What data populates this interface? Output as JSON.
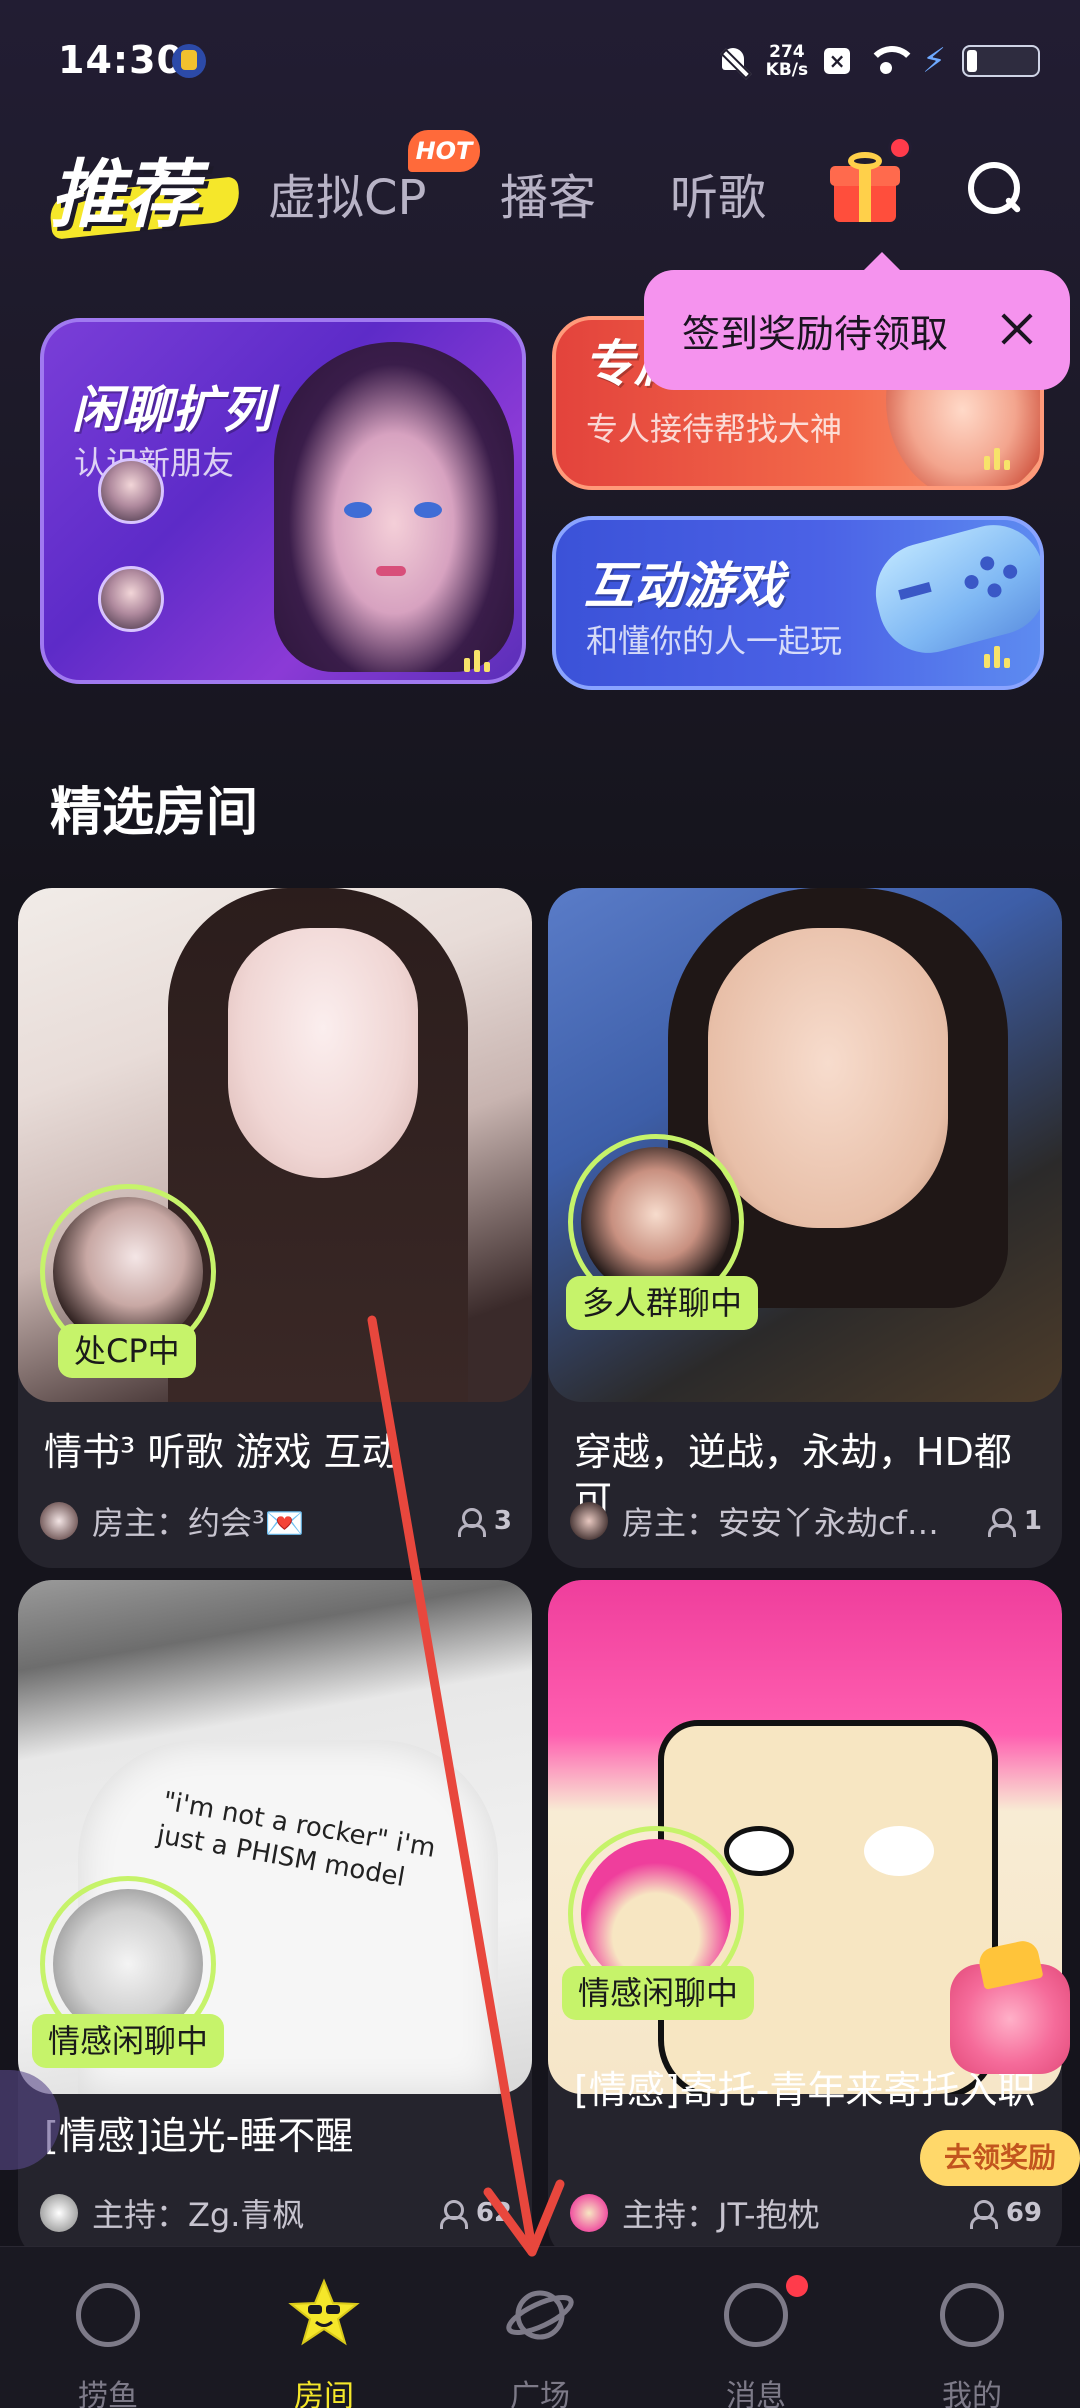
{
  "status_bar": {
    "time": "14:30",
    "speed_value": "274",
    "speed_unit": "KB/s",
    "x_badge": "×"
  },
  "top_tabs": {
    "active": "推荐",
    "tabs": [
      "虚拟CP",
      "播客",
      "听歌"
    ],
    "hot_badge": "HOT"
  },
  "tooltip": {
    "text": "签到奖励待领取"
  },
  "banners": {
    "chat": {
      "title": "闲聊扩列",
      "subtitle": "认识新朋友"
    },
    "special": {
      "title": "专属陪玩",
      "subtitle": "专人接待帮找大神"
    },
    "games": {
      "title": "互动游戏",
      "subtitle": "和懂你的人一起玩"
    }
  },
  "section": {
    "title": "精选房间"
  },
  "rooms": [
    {
      "status": "处CP中",
      "title": "情书³ 听歌 游戏 互动",
      "host": "房主：约会³💌",
      "count": "3"
    },
    {
      "status": "多人群聊中",
      "title": "穿越，逆战，永劫，HD都可",
      "host": "房主：安安丫永劫cf…",
      "count": "1"
    },
    {
      "status": "情感闲聊中",
      "title": "[情感]追光-睡不醒",
      "host": "主持：Zg.青枫",
      "count": "62"
    },
    {
      "status": "情感闲聊中",
      "title": "[情感]寄托-青年来寄托入职",
      "host": "主持：JT-抱枕",
      "count": "69"
    }
  ],
  "cover_text": {
    "shirt": "\"i'm not a rocker\" i'm just a PHISM model"
  },
  "reward": {
    "label": "去领奖励"
  },
  "bottom_nav": {
    "items": [
      {
        "label": "捞鱼",
        "icon": "voice-bubble-icon"
      },
      {
        "label": "房间",
        "icon": "star-face-icon",
        "active": true
      },
      {
        "label": "广场",
        "icon": "planet-icon"
      },
      {
        "label": "消息",
        "icon": "hi-bubble-icon"
      },
      {
        "label": "我的",
        "icon": "smile-bubble-icon"
      }
    ]
  },
  "colors": {
    "background": "#15141c",
    "accent_yellow": "#f5e72a",
    "tag_green": "#c6f36a",
    "tooltip_pink": "#f593ee",
    "badge_red": "#ff3b4b",
    "annotation_red": "#e8473d"
  }
}
